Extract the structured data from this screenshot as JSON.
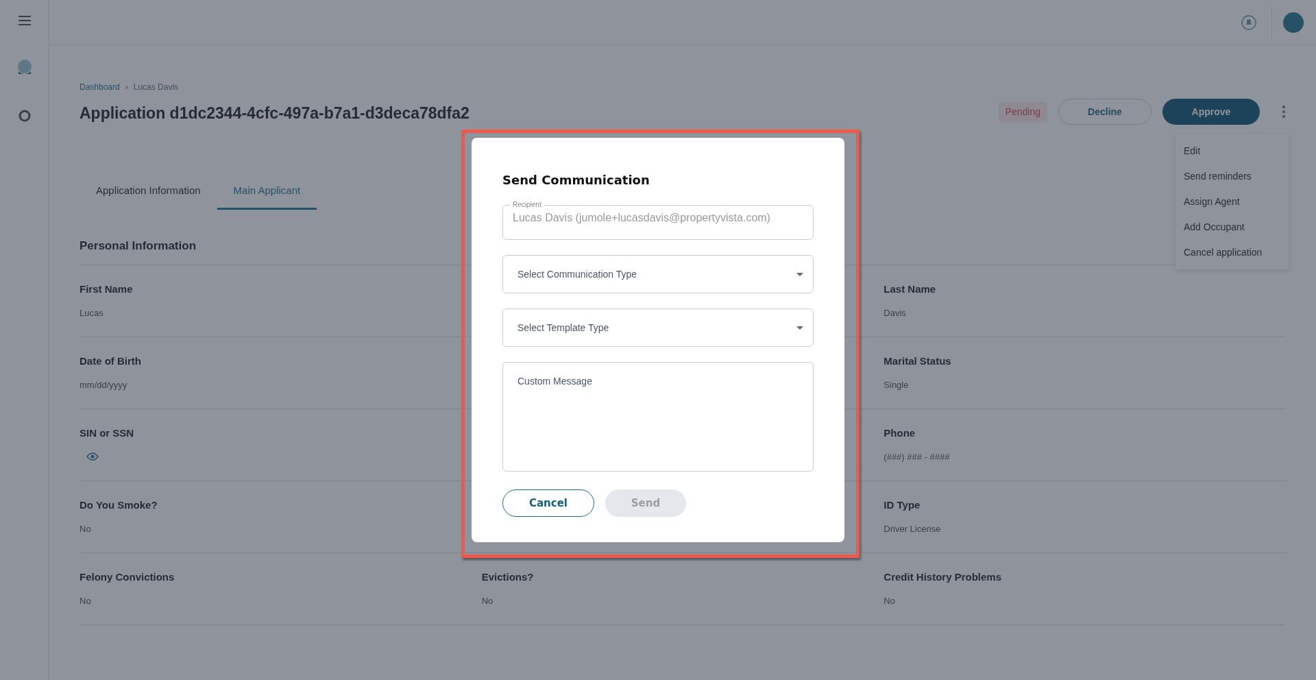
{
  "breadcrumb": {
    "items": [
      "Dashboard",
      "Lucas Davis"
    ],
    "separator": "›"
  },
  "page_title": "Application d1dc2344-4cfc-497a-b7a1-d3deca78dfa2",
  "status_badge": "Pending",
  "actions": {
    "decline": "Decline",
    "approve": "Approve"
  },
  "actions_menu": [
    "Edit",
    "Send reminders",
    "Assign Agent",
    "Add Occupant",
    "Cancel application"
  ],
  "tabs": [
    {
      "label": "Application Information",
      "selected": false
    },
    {
      "label": "Main Applicant",
      "selected": true
    }
  ],
  "section_title": "Personal Information",
  "rows": [
    {
      "left": {
        "label": "First Name",
        "value": "Lucas"
      },
      "right": {
        "label": "Last Name",
        "value": "Davis"
      }
    },
    {
      "left": {
        "label": "Date of Birth",
        "value": "mm/dd/yyyy"
      },
      "right": {
        "label": "Marital Status",
        "value": "Single"
      }
    },
    {
      "left": {
        "label": "SIN or SSN",
        "kind": "hidden"
      },
      "right": {
        "label": "Phone",
        "value": "(###) ### - ####"
      }
    },
    {
      "left": {
        "label": "Do You Smoke?",
        "value": "No"
      },
      "right": {
        "label": "ID Type",
        "value": "Driver License"
      }
    },
    {
      "left": {
        "label": "Felony Convictions",
        "value": "No"
      },
      "middle": {
        "label": "Evictions?",
        "value": "No"
      },
      "right": {
        "label": "Credit History Problems",
        "value": "No"
      }
    }
  ],
  "dialog": {
    "title": "Send Communication",
    "recipient": {
      "label": "Recipient",
      "value": "Lucas Davis (jumole+lucasdavis@propertyvista.com)"
    },
    "communication_type": {
      "placeholder": "Select Communication Type"
    },
    "template_type": {
      "placeholder": "Select Template Type"
    },
    "message": {
      "placeholder": "Custom Message"
    },
    "buttons": [
      {
        "label": "Cancel",
        "kind": "outline",
        "disabled": false
      },
      {
        "label": "Send",
        "kind": "primary",
        "disabled": true
      }
    ]
  }
}
